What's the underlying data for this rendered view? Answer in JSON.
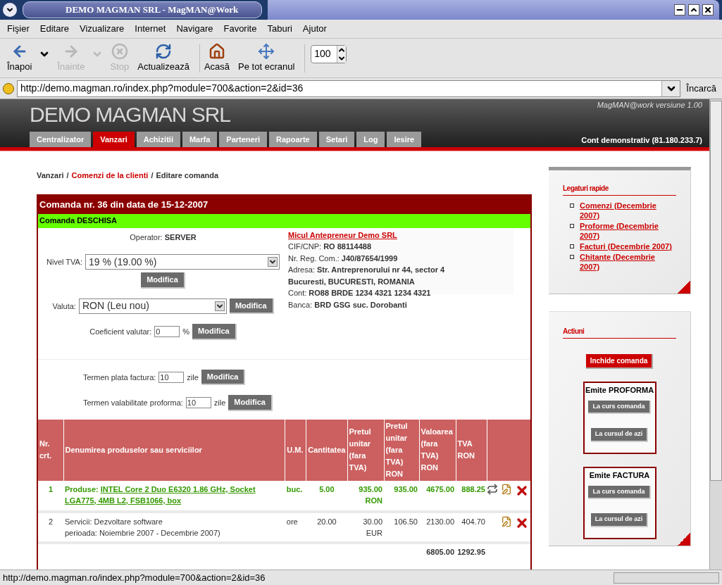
{
  "window": {
    "title": "DEMO MAGMAN SRL - MagMAN@Work"
  },
  "menu": [
    "Fişier",
    "Editare",
    "Vizualizare",
    "Internet",
    "Navigare",
    "Favorite",
    "Taburi",
    "Ajutor"
  ],
  "toolbar": [
    {
      "kind": "back",
      "label": "Înapoi",
      "disabled": false,
      "dropdown": true
    },
    {
      "kind": "forward",
      "label": "Înainte",
      "disabled": true,
      "dropdown": true
    },
    {
      "kind": "stop",
      "label": "Stop",
      "disabled": true,
      "dropdown": false
    },
    {
      "kind": "reload",
      "label": "Actualizează",
      "disabled": false,
      "dropdown": false
    },
    {
      "kind": "home",
      "label": "Acasă",
      "disabled": false,
      "dropdown": false
    },
    {
      "kind": "fullscreen",
      "label": "Pe tot ecranul",
      "disabled": false,
      "dropdown": false
    }
  ],
  "zoom": "100",
  "address": {
    "url": "http://demo.magman.ro/index.php?module=700&action=2&id=36",
    "go": "Încarcă"
  },
  "site": {
    "title": "DEMO MAGMAN SRL",
    "version": "MagMAN@work versiune 1.00",
    "account": "Cont demonstrativ (81.180.233.7)",
    "tabs": [
      {
        "label": "Centralizator",
        "selected": false
      },
      {
        "label": "Vanzari",
        "selected": true
      },
      {
        "label": "Achizitii",
        "selected": false
      },
      {
        "label": "Marfa",
        "selected": false
      },
      {
        "label": "Parteneri",
        "selected": false
      },
      {
        "label": "Rapoarte",
        "selected": false
      },
      {
        "label": "Setari",
        "selected": false
      },
      {
        "label": "Log",
        "selected": false
      },
      {
        "label": "Iesire",
        "selected": false
      }
    ]
  },
  "breadcrumb": [
    {
      "kind": "text",
      "text": "Vanzari"
    },
    {
      "kind": "separator",
      "text": "/"
    },
    {
      "kind": "link",
      "text": "Comenzi de la clienti"
    },
    {
      "kind": "separator",
      "text": "/"
    },
    {
      "kind": "text",
      "text": "Editare comanda"
    }
  ],
  "order": {
    "title": "Comanda nr. 36 din data de 15-12-2007",
    "status": "Comanda DESCHISA",
    "operator_label": "Operator:",
    "operator": "SERVER",
    "fields": [
      {
        "kind": "select",
        "label": "Nivel TVA:",
        "value": "19 % (19.00 %)",
        "button": "Modifica"
      },
      {
        "kind": "select",
        "label": "Valuta:",
        "value": "RON (Leu nou)",
        "button": "Modifica"
      },
      {
        "kind": "input",
        "label": "Coeficient valutar:",
        "value": "0",
        "unit": "%",
        "button": "Modifica"
      },
      {
        "kind": "input",
        "label": "Termen plata factura:",
        "value": "10",
        "unit": "zile",
        "button": "Modifica"
      },
      {
        "kind": "input",
        "label": "Termen valabilitate proforma:",
        "value": "10",
        "unit": "zile",
        "button": "Modifica"
      }
    ]
  },
  "client": {
    "name": "Micul Antepreneur Demo SRL",
    "lines": [
      {
        "label": "CIF/CNP:",
        "value": "RO 88114488"
      },
      {
        "label": "Nr. Reg. Com.:",
        "value": "J40/87654/1999"
      },
      {
        "label": "Adresa:",
        "value": "Str. Antreprenorului nr 44, sector 4"
      },
      {
        "value": "Bucuresti, BUCURESTI, ROMANIA"
      },
      {
        "label": "Cont:",
        "value": "RO88 BRDE 1234 4321 1234 4321"
      },
      {
        "label": "Banca:",
        "value": "BRD GSG suc. Dorobanti"
      }
    ]
  },
  "table": {
    "columns": [
      "Nr. crt.",
      "Denumirea produselor sau serviciilor",
      "U.M.",
      "Cantitatea",
      "Pretul unitar (fara TVA)",
      "Pretul unitar (fara TVA) RON",
      "Valoarea (fara TVA) RON",
      "TVA RON"
    ],
    "rows": [
      {
        "highlighted": true,
        "nr": "1",
        "prefix": "Produse:",
        "name": "INTEL Core 2 Duo E6320 1.86 GHz, Socket LGA775, 4MB L2, FSB1066, box",
        "linked": true,
        "um": "buc.",
        "qty": "5.00",
        "price": "935.00",
        "currency": "RON",
        "price_ron": "935.00",
        "value": "4675.00",
        "vat": "888.25",
        "convertible": true
      },
      {
        "highlighted": false,
        "nr": "2",
        "prefix": "Servicii:",
        "name": "Dezvoltare software",
        "extra": "perioada: Noiembrie 2007 - Decembrie 2007)",
        "linked": false,
        "um": "ore",
        "qty": "20.00",
        "price": "30.00",
        "currency": "EUR",
        "price_ron": "106.50",
        "value": "2130.00",
        "vat": "404.70",
        "convertible": false
      }
    ],
    "totals": {
      "value": "6805.00",
      "vat": "1292.95"
    }
  },
  "sidebar": {
    "links_title": "Legaturi rapide",
    "links": [
      "Comenzi (Decembrie 2007)",
      "Proforme (Decembrie 2007)",
      "Facturi (Decembrie 2007)",
      "Chitante (Decembrie 2007)"
    ],
    "actions_title": "Actiuni",
    "close_button": "Inchide comanda",
    "groups": [
      {
        "title": "Emite PROFORMA",
        "buttons": [
          "La curs comanda",
          "La cursul de azi"
        ]
      },
      {
        "title": "Emite FACTURA",
        "buttons": [
          "La curs comanda",
          "La cursul de azi"
        ]
      }
    ]
  },
  "status_bar": {
    "text": "http://demo.magman.ro/index.php?module=700&action=2&id=36"
  }
}
